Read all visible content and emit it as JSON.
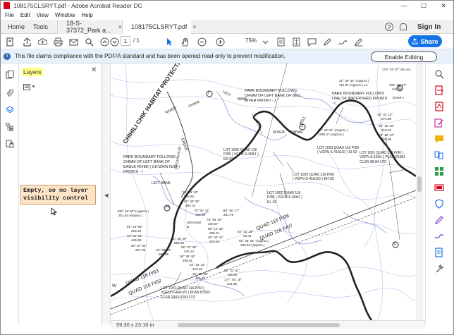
{
  "window": {
    "title": "108175CLSRYT.pdf - Adobe Acrobat Reader DC",
    "minimize": "—",
    "maximize": "☐",
    "close": "✕"
  },
  "menu": [
    "File",
    "Edit",
    "View",
    "Window",
    "Help"
  ],
  "tabs": {
    "home": "Home",
    "tools": "Tools",
    "doc1": "18-S-37372_Park a...",
    "doc2": "108175CLSRYT.pdf",
    "close": "×"
  },
  "header": {
    "help": "?",
    "sign_in": "Sign In"
  },
  "toolbar": {
    "page_current": "1",
    "page_total": "/ 1",
    "zoom": "75%",
    "share": "Share"
  },
  "infobar": {
    "message": "This file claims compliance with the PDF/A standard and has been opened read-only to prevent modification.",
    "enable_editing": "Enable Editing"
  },
  "layers_panel": {
    "title": "Layers",
    "close": "✕",
    "annotation": "Empty, so no layer visibility control"
  },
  "status": {
    "dimensions": "59.30 x 23.10 in"
  },
  "map_labels": {
    "area": "CHIHILI CHIK HABITAT PROTECTION AREA",
    "park1": "PARK BOUNDARY FOLLOWS OHWM OF LEFT BANK OF BELL RIVER FROM I - J",
    "park2": "PARK BOUNDARY FOLLOWS LINE OF WATERSHED FROM K - L",
    "park3": "PARK BOUNDARY FOLLOWS OHWM OF LEFT BANK OF EAGLE RIVER ( CH'IZHIN NJIK ) FROM H - I",
    "lot1002a": "LOT 1002 QUAD 116 P/06 ( VGFN S-39A1 ) EK-02",
    "lot1003a": "LOT 1003 QUAD 116 P/06 ( VGFN S-41A1/D ) EI-02",
    "lot1003b": "LOT 1003 QUAD 116 P/06 ( VGFN S-41A1/D ) EH-02",
    "lot1002b": "LOT 1002 QUAD 116 P/06 ( VGFN S-39A1 ) EL-02",
    "lot1001a": "LOT 1001 QUAD 116 P/06 ( VGFN S-16A1 ) PLAN 81381 CLSR 98-84 LTO",
    "lot1001b": "LOT 1001 QUAD 116 P/03 ( VGFN S-40A1/D ) PLAN 87533 CLSR 2003-0203 LTO",
    "quad1": "QUAD 116 P/06",
    "quad2": "QUAD 116 P/07",
    "quad3": "QUAD 116 P/03",
    "quad4": "QUAD 116 P/02",
    "bell": "BELL",
    "eagle": "EAGLE",
    "river1": "RIVER",
    "river2": "RIVER",
    "ohwm1": "OHWM",
    "ohwm2": "OHWM",
    "bank": "BANK",
    "left": "LEFT",
    "left_bank2": "LEFT BANK",
    "chizhin": "CH'IZHIN NJIK",
    "i_marker": "I",
    "j_marker": "J",
    "k_marker": "K",
    "l_marker": "L",
    "h_marker": "H",
    "west": "W",
    "c1": "176° 03' 07\" 261.84",
    "c2": "21° 39' 34\" (Approx.)",
    "c3": "114.37 (Approx.) 13",
    "c4": "232° 33' 37\"",
    "c5": "244.92",
    "c6": "Detail A",
    "c7": "32° 31' 13\"",
    "c8": "274.86",
    "c9": "29° 12' 18\"",
    "c10": "315.62",
    "c11": "23° 12' 12\"",
    "c12": "320.05",
    "c13": "27° 46' 04\" (Approx.)",
    "c14": "1390.47 (Approx.)",
    "c15": "39° 25' 36\"",
    "c16": "266.54",
    "c17": "50° 30' 38\"",
    "c18": "594.15",
    "c19": "76° 52' 47\"",
    "c20": "455.88",
    "c21": "118° 50' 27\"",
    "c22": "281.76",
    "c23": "78° 56' 30\"",
    "c24": "400.87",
    "c25": "66° 14' 36\"",
    "c26": "296.34",
    "c27": "45° 32' 41\"",
    "c28": "203.48",
    "c29": "83° 21' 28\"",
    "c30": "26.44",
    "c31": "52° 49' 25\" (Approx.)",
    "c32": "188.48 (Approx.)",
    "c33": "139° 18' 50\" (Approx.)",
    "c34": "251.84 (Approx.)",
    "c35": "81° 10' 58\"",
    "c36": "263.33",
    "c37": "42° 01' 01\"",
    "c38": "446.98",
    "c39": "50° 57' 04\"",
    "c40": "267.39",
    "c41": "46° 59' 22\"",
    "c42": "598.08",
    "c43": "71° 28' 29\"",
    "c44": "585.50",
    "c45": "55° 07' 48\"",
    "c46": "478.12",
    "c47": "58° 39' 42\"",
    "c48": "205.01",
    "c49": "10° 13' 12\"",
    "c50": "315.20",
    "c51": "41° 29' 10\"",
    "c52": "416.24",
    "c53": "52° 31' 51\"",
    "c54": "729.05",
    "c55": "177° 46' 18\"",
    "c56": "341.95",
    "c57": "Sld Detail B"
  }
}
